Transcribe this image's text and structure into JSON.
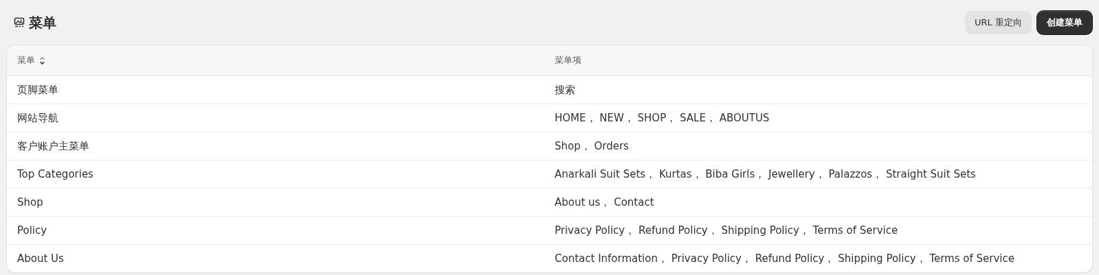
{
  "page": {
    "title": "菜单"
  },
  "buttons": [
    {
      "label": "URL 重定向",
      "kind": "secondary"
    },
    {
      "label": "创建菜单",
      "kind": "primary"
    }
  ],
  "table": {
    "columns": [
      "菜单",
      "菜单项"
    ],
    "rows": [
      {
        "menu": "页脚菜单",
        "items": "搜索"
      },
      {
        "menu": "网站导航",
        "items": "HOME， NEW， SHOP， SALE， ABOUTUS"
      },
      {
        "menu": "客户账户主菜单",
        "items": "Shop， Orders"
      },
      {
        "menu": "Top Categories",
        "items": "Anarkali Suit Sets， Kurtas， Biba Girls， Jewellery， Palazzos， Straight Suit Sets"
      },
      {
        "menu": "Shop",
        "items": "About us， Contact"
      },
      {
        "menu": "Policy",
        "items": "Privacy Policy， Refund Policy， Shipping Policy， Terms of Service"
      },
      {
        "menu": "About Us",
        "items": "Contact Information， Privacy Policy， Refund Policy， Shipping Policy， Terms of Service"
      }
    ]
  }
}
